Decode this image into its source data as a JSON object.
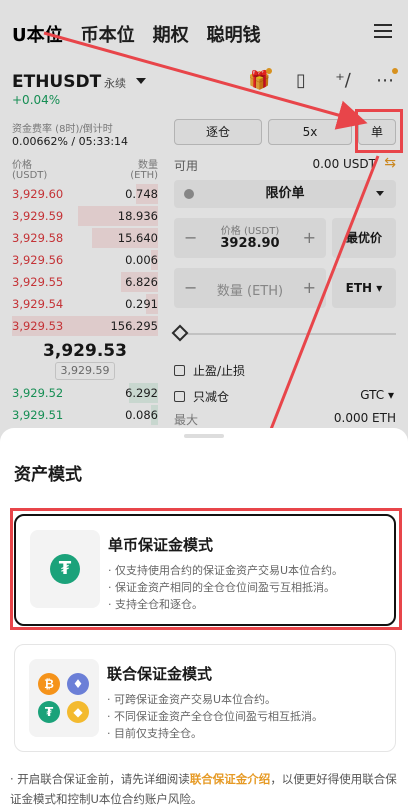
{
  "topnav": {
    "tabs": [
      "U本位",
      "币本位",
      "期权",
      "聪明钱"
    ]
  },
  "ticker": {
    "symbol": "ETHUSDT",
    "contract": "永续",
    "change": "+0.04%"
  },
  "funding": {
    "label": "资金费率 (8时)/倒计时",
    "value": "0.00662% / 05:33:14"
  },
  "orderbook": {
    "price_label": "价格",
    "price_unit": "(USDT)",
    "qty_label": "数量",
    "qty_unit": "(ETH)",
    "asks": [
      {
        "price": "3,929.60",
        "qty": "0.748",
        "depth": 0.15
      },
      {
        "price": "3,929.59",
        "qty": "18.936",
        "depth": 0.55
      },
      {
        "price": "3,929.58",
        "qty": "15.640",
        "depth": 0.45
      },
      {
        "price": "3,929.56",
        "qty": "0.006",
        "depth": 0.05
      },
      {
        "price": "3,929.55",
        "qty": "6.826",
        "depth": 0.25
      },
      {
        "price": "3,929.54",
        "qty": "0.291",
        "depth": 0.08
      },
      {
        "price": "3,929.53",
        "qty": "156.295",
        "depth": 1.0
      }
    ],
    "last_price": "3,929.53",
    "mark_price": "3,929.59",
    "bids": [
      {
        "price": "3,929.52",
        "qty": "6.292",
        "depth": 0.2
      },
      {
        "price": "3,929.51",
        "qty": "0.086",
        "depth": 0.05
      }
    ]
  },
  "order_form": {
    "margin_mode": "逐仓",
    "leverage": "5x",
    "asset_mode_btn": "单",
    "available_label": "可用",
    "available_value": "0.00 USDT",
    "order_type": "限价单",
    "price_label": "价格 (USDT)",
    "price_value": "3928.90",
    "best_price": "最优价",
    "qty_placeholder": "数量 (ETH)",
    "qty_unit": "ETH",
    "tp_sl": "止盈/止损",
    "reduce_only": "只减仓",
    "tif": "GTC",
    "max_label": "最大",
    "max_value": "0.000 ETH"
  },
  "sheet": {
    "title": "资产模式",
    "single": {
      "title": "单币保证金模式",
      "lines": [
        "· 仅支持使用合约的保证金资产交易U本位合约。",
        "· 保证金资产相同的全仓仓位间盈亏互相抵消。",
        "· 支持全仓和逐仓。"
      ]
    },
    "multi": {
      "title": "联合保证金模式",
      "lines": [
        "· 可跨保证金资产交易U本位合约。",
        "· 不同保证金资产全仓仓位间盈亏相互抵消。",
        "· 目前仅支持全仓。"
      ]
    },
    "note_prefix": "· 开启联合保证金前，请先详细阅读",
    "note_link": "联合保证金介绍",
    "note_suffix": "，以便更好得使用联合保证金模式和控制U本位合约账户风险。"
  },
  "colors": {
    "ask": "#e03a3e",
    "bid": "#1aa260",
    "accent": "#e69a25",
    "highlight": "#e8454a",
    "tether": "#1ba27a"
  }
}
